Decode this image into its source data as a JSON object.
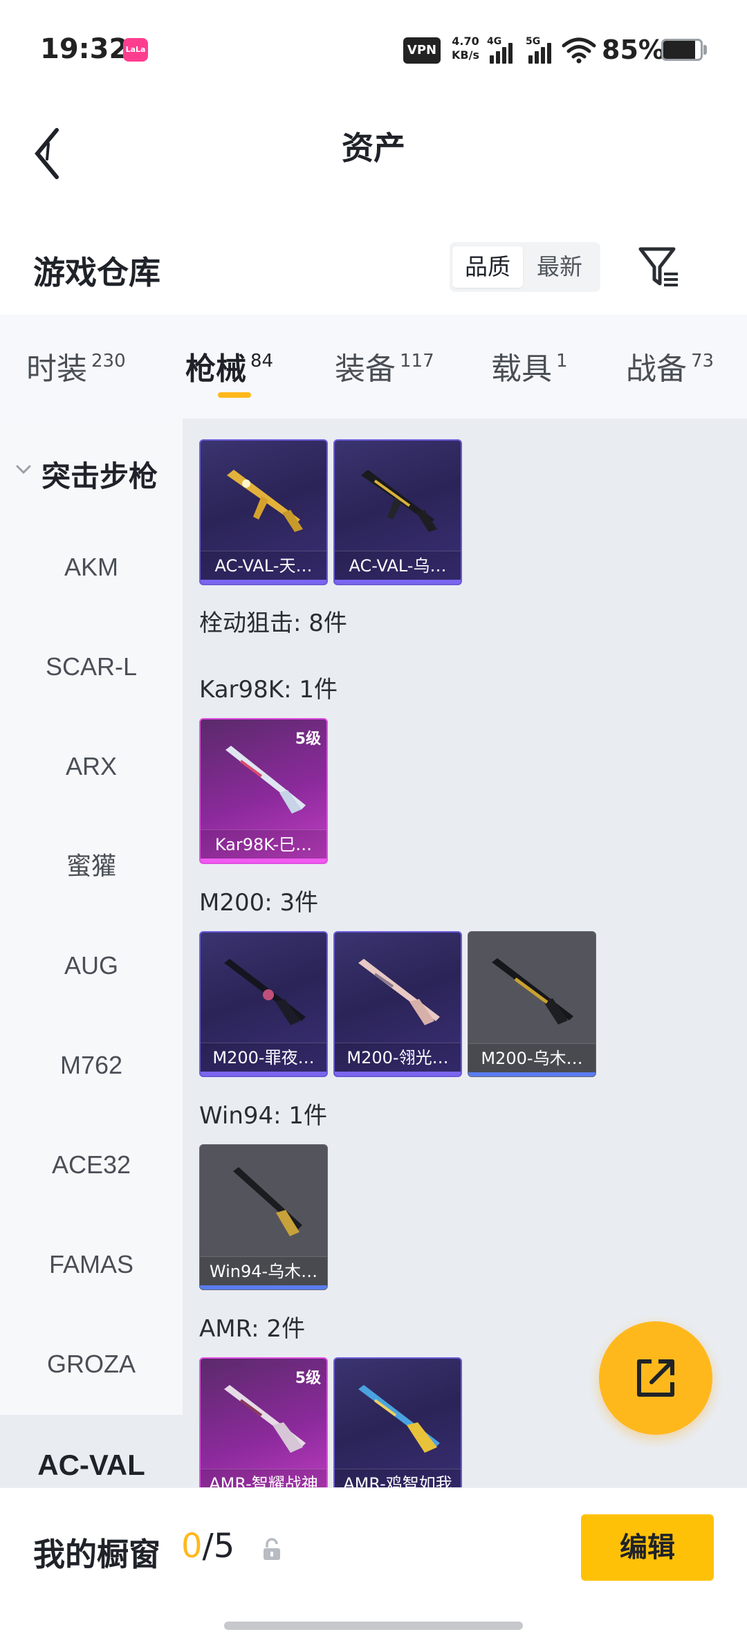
{
  "status_bar": {
    "time": "19:32",
    "app_badge": "LaLa",
    "vpn": "VPN",
    "speed_value": "4.70",
    "speed_unit": "KB/s",
    "net1": "4G",
    "net2": "5G",
    "battery": "85%",
    "battery_level": 0.85
  },
  "header": {
    "title": "资产"
  },
  "warehouse": {
    "title": "游戏仓库",
    "sort_options": [
      "品质",
      "最新"
    ],
    "active_sort": "品质"
  },
  "tabs": [
    {
      "label": "时装",
      "count": "230"
    },
    {
      "label": "枪械",
      "count": "84",
      "active": true
    },
    {
      "label": "装备",
      "count": "117"
    },
    {
      "label": "载具",
      "count": "1"
    },
    {
      "label": "战备",
      "count": "73"
    }
  ],
  "sidebar": {
    "group": "突击步枪",
    "items": [
      "AKM",
      "SCAR-L",
      "ARX",
      "蜜獾",
      "AUG",
      "M762",
      "ACE32",
      "FAMAS",
      "GROZA",
      "AC-VAL"
    ],
    "active": "AC-VAL"
  },
  "content": {
    "top_cards": [
      {
        "name": "AC-VAL-天…",
        "rarity": "purple"
      },
      {
        "name": "AC-VAL-乌…",
        "rarity": "purple"
      }
    ],
    "category_title": "栓动狙击: 8件",
    "sections": [
      {
        "title": "Kar98K: 1件",
        "cards": [
          {
            "name": "Kar98K-巳…",
            "rarity": "pink",
            "level": "5级"
          }
        ]
      },
      {
        "title": "M200: 3件",
        "cards": [
          {
            "name": "M200-罪夜…",
            "rarity": "purple"
          },
          {
            "name": "M200-翎光…",
            "rarity": "purple"
          },
          {
            "name": "M200-乌木…",
            "rarity": "gray"
          }
        ]
      },
      {
        "title": "Win94: 1件",
        "cards": [
          {
            "name": "Win94-乌木…",
            "rarity": "gray"
          }
        ]
      },
      {
        "title": "AMR: 2件",
        "cards": [
          {
            "name": "AMR-智耀战神",
            "rarity": "pink",
            "level": "5级"
          },
          {
            "name": "AMR-鸡智如我",
            "rarity": "purple"
          }
        ]
      }
    ]
  },
  "showcase": {
    "title": "我的橱窗",
    "current": "0",
    "total": "/5"
  },
  "edit_button": "编辑",
  "colors": {
    "accent": "#ffb81c",
    "purple_rarity": "#7a66f0",
    "pink_rarity": "#f05af0",
    "gray_rarity": "#5a7cf0"
  }
}
